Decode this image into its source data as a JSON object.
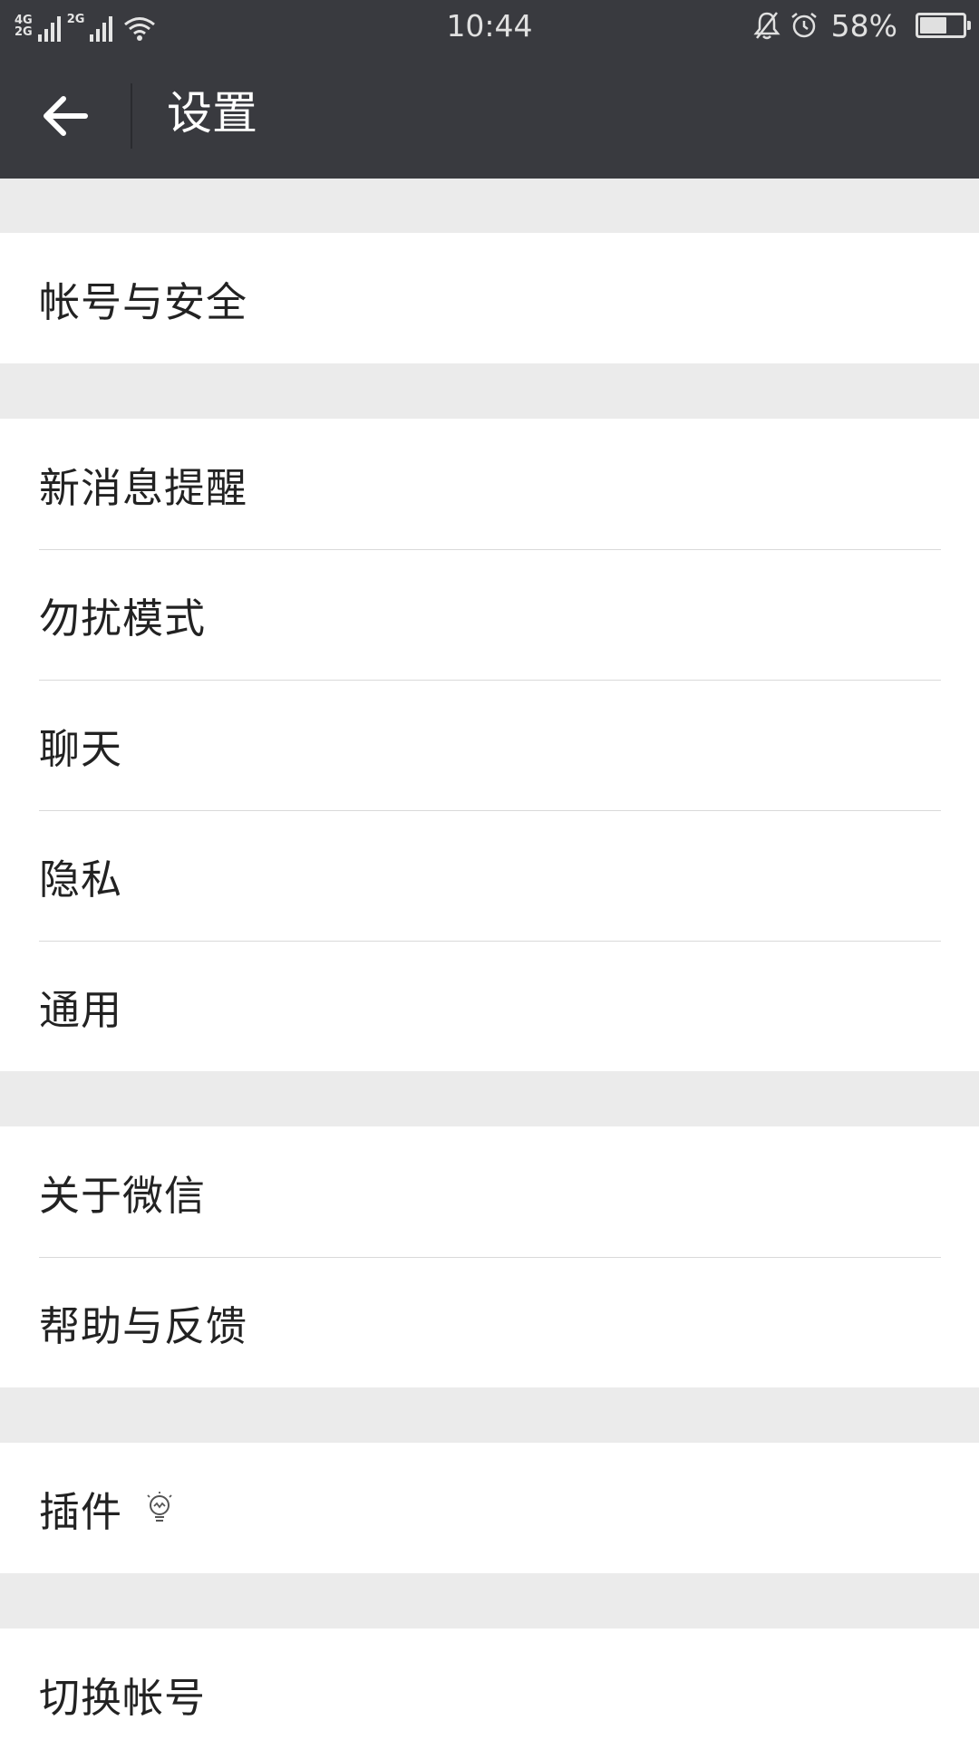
{
  "status_bar": {
    "network_top": "4G",
    "network_bottom": "2G",
    "network_2": "2G",
    "time": "10:44",
    "battery_text": "58%",
    "battery_level": 0.58,
    "icons": [
      "mute-bell-icon",
      "alarm-icon",
      "wifi-icon",
      "signal-icon",
      "battery-icon"
    ]
  },
  "nav": {
    "title": "设置",
    "back_icon": "arrow-left-icon"
  },
  "colors": {
    "topbar": "#393a3f",
    "background": "#ebebeb",
    "row": "#ffffff",
    "divider": "#d9d9d9",
    "text": "#222222"
  },
  "groups": [
    {
      "items": [
        {
          "label": "帐号与安全"
        }
      ]
    },
    {
      "items": [
        {
          "label": "新消息提醒"
        },
        {
          "label": "勿扰模式"
        },
        {
          "label": "聊天"
        },
        {
          "label": "隐私"
        },
        {
          "label": "通用"
        }
      ]
    },
    {
      "items": [
        {
          "label": "关于微信"
        },
        {
          "label": "帮助与反馈"
        }
      ]
    },
    {
      "items": [
        {
          "label": "插件",
          "icon": "lightbulb-icon"
        }
      ]
    },
    {
      "items": [
        {
          "label": "切换帐号"
        }
      ]
    }
  ]
}
